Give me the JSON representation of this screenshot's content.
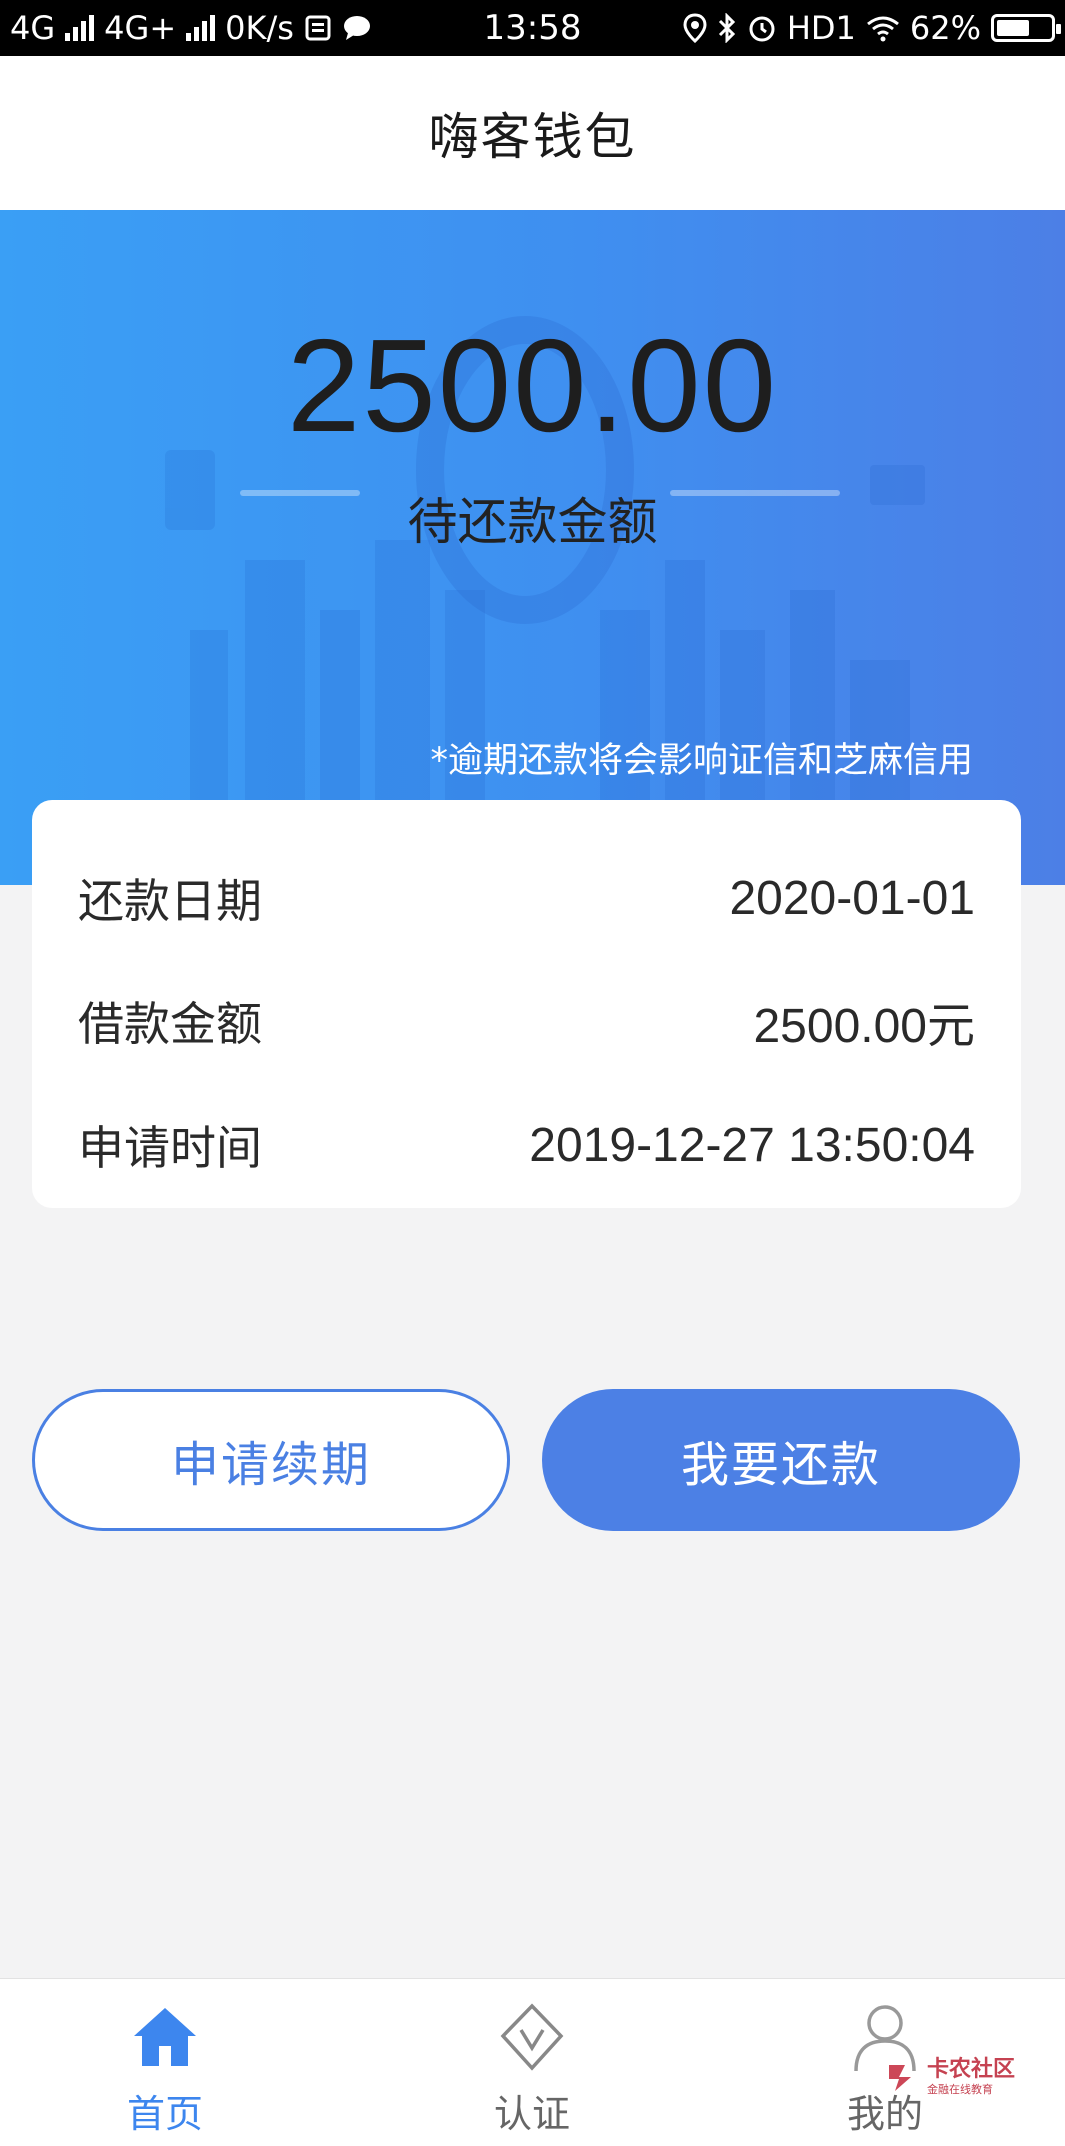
{
  "status_bar": {
    "network_1": "4G",
    "network_2": "4G+",
    "speed": "0K/s",
    "time": "13:58",
    "hd": "HD1",
    "battery": "62%",
    "battery_level": 0.62
  },
  "header": {
    "title": "嗨客钱包"
  },
  "hero": {
    "amount": "2500.00",
    "amount_label": "待还款金额",
    "warning": "*逾期还款将会影响证信和芝麻信用"
  },
  "details": {
    "rows": [
      {
        "label": "还款日期",
        "value": "2020-01-01"
      },
      {
        "label": "借款金额",
        "value": "2500.00元"
      },
      {
        "label": "申请时间",
        "value": "2019-12-27 13:50:04"
      }
    ]
  },
  "actions": {
    "extend_label": "申请续期",
    "repay_label": "我要还款"
  },
  "tabbar": {
    "items": [
      {
        "label": "首页",
        "icon": "home-icon",
        "active": true
      },
      {
        "label": "认证",
        "icon": "verify-icon",
        "active": false
      },
      {
        "label": "我的",
        "icon": "user-icon",
        "active": false
      }
    ]
  },
  "watermark": {
    "main": "卡农社区",
    "sub": "金融在线教育"
  },
  "colors": {
    "accent": "#4c80e5",
    "hero_start": "#3a9ff5",
    "hero_end": "#4c7fe6",
    "tab_active": "#3d86ee"
  }
}
